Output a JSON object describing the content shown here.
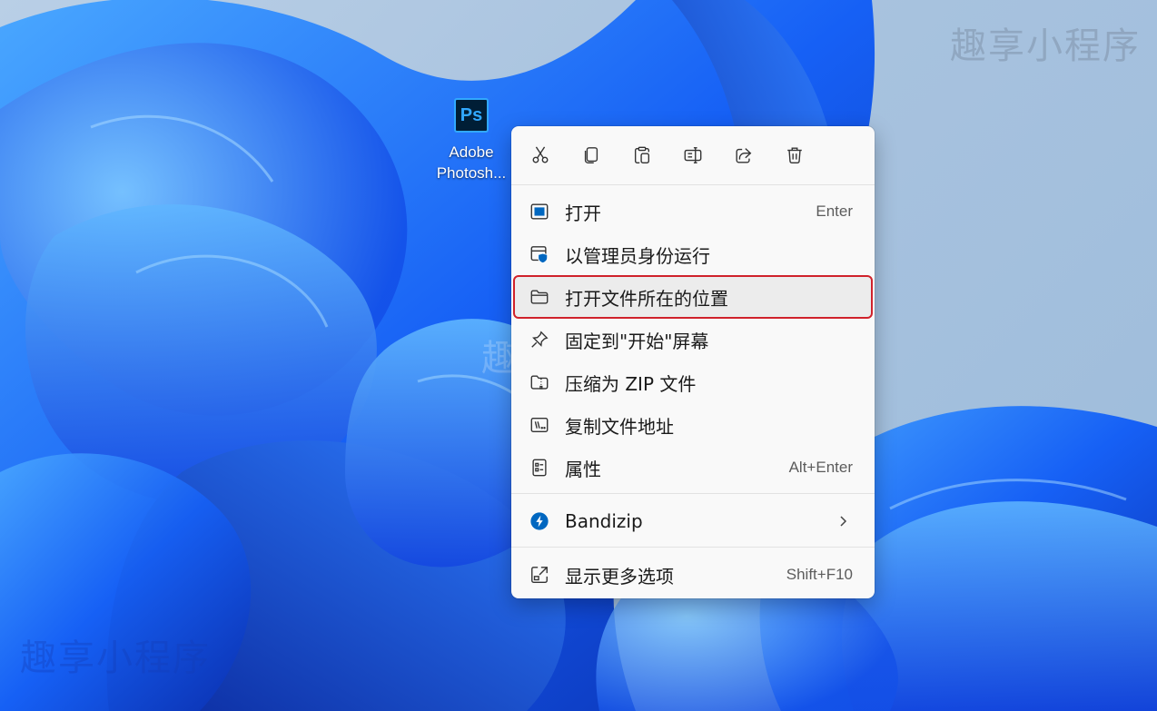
{
  "watermark": {
    "text": "趣享小程序"
  },
  "desktop_icon": {
    "glyph": "Ps",
    "label_line1": "Adobe",
    "label_line2": "Photosh..."
  },
  "context_menu": {
    "toolbar": [
      "cut-icon",
      "copy-icon",
      "paste-icon",
      "rename-icon",
      "share-icon",
      "delete-icon"
    ],
    "items": [
      {
        "label": "打开",
        "shortcut": "Enter",
        "icon": "open-icon"
      },
      {
        "label": "以管理员身份运行",
        "shortcut": "",
        "icon": "admin-shield-icon"
      },
      {
        "label": "打开文件所在的位置",
        "shortcut": "",
        "icon": "folder-icon"
      },
      {
        "label": "固定到\"开始\"屏幕",
        "shortcut": "",
        "icon": "pin-icon"
      },
      {
        "label": "压缩为 ZIP 文件",
        "shortcut": "",
        "icon": "zip-folder-icon"
      },
      {
        "label": "复制文件地址",
        "shortcut": "",
        "icon": "copy-path-icon"
      },
      {
        "label": "属性",
        "shortcut": "Alt+Enter",
        "icon": "properties-icon"
      },
      {
        "label": "Bandizip",
        "shortcut": "",
        "icon": "bandizip-icon"
      },
      {
        "label": "显示更多选项",
        "shortcut": "Shift+F10",
        "icon": "more-options-icon"
      }
    ]
  },
  "colors": {
    "accent": "#0067c0",
    "highlight_border": "#d0222b",
    "wallpaper_blue": "#1a5cff"
  }
}
